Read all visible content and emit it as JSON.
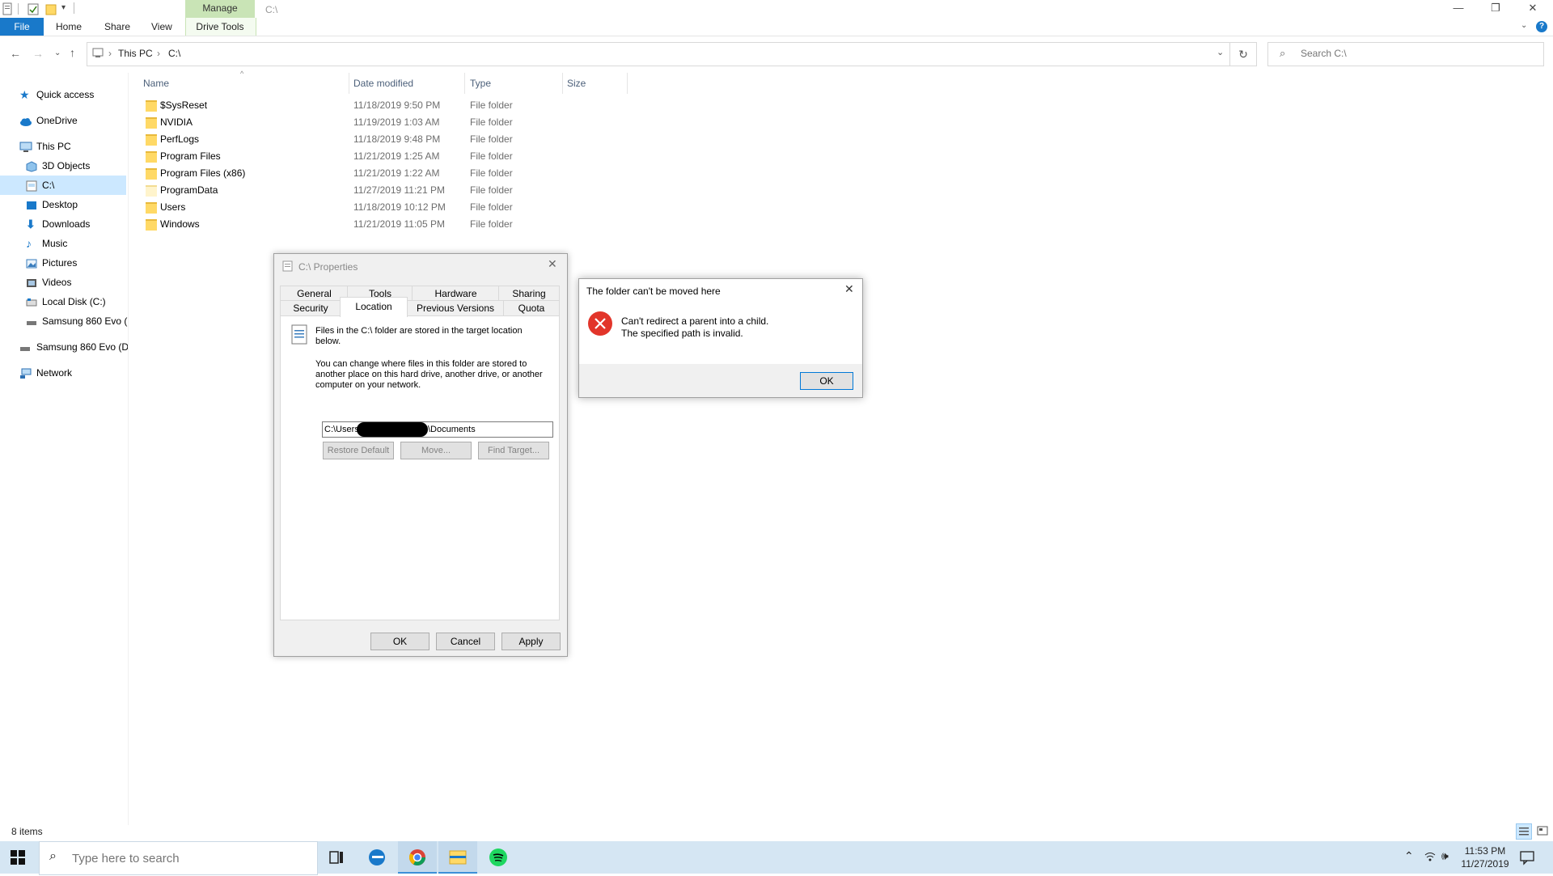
{
  "window": {
    "title": "C:\\",
    "manage_label": "Manage",
    "drive_tools_label": "Drive Tools",
    "controls": [
      "—",
      "❐",
      "✕"
    ]
  },
  "ribbon": {
    "file": "File",
    "tabs": [
      "Home",
      "Share",
      "View"
    ],
    "help": "?"
  },
  "address": {
    "crumbs": [
      "This PC",
      "C:\\"
    ],
    "search_placeholder": "Search C:\\"
  },
  "nav": {
    "items": [
      {
        "label": "Quick access",
        "icon": "star-icon"
      },
      {
        "label": "OneDrive",
        "icon": "cloud-icon"
      },
      {
        "label": "This PC",
        "icon": "computer-icon"
      },
      {
        "label": "3D Objects",
        "icon": "cube-icon"
      },
      {
        "label": "C:\\",
        "icon": "drive-icon"
      },
      {
        "label": "Desktop",
        "icon": "desktop-icon"
      },
      {
        "label": "Downloads",
        "icon": "download-icon"
      },
      {
        "label": "Music",
        "icon": "music-icon"
      },
      {
        "label": "Pictures",
        "icon": "pictures-icon"
      },
      {
        "label": "Videos",
        "icon": "video-icon"
      },
      {
        "label": "Local Disk (C:)",
        "icon": "drive-icon"
      },
      {
        "label": "Samsung 860 Evo (",
        "icon": "drive-icon"
      },
      {
        "label": "Samsung 860 Evo  (D:",
        "icon": "drive-icon"
      },
      {
        "label": "Network",
        "icon": "network-icon"
      }
    ]
  },
  "columns": [
    "Name",
    "Date modified",
    "Type",
    "Size"
  ],
  "files": [
    {
      "name": "$SysReset",
      "date": "11/18/2019 9:50 PM",
      "type": "File folder"
    },
    {
      "name": "NVIDIA",
      "date": "11/19/2019 1:03 AM",
      "type": "File folder"
    },
    {
      "name": "PerfLogs",
      "date": "11/18/2019 9:48 PM",
      "type": "File folder"
    },
    {
      "name": "Program Files",
      "date": "11/21/2019 1:25 AM",
      "type": "File folder"
    },
    {
      "name": "Program Files (x86)",
      "date": "11/21/2019 1:22 AM",
      "type": "File folder"
    },
    {
      "name": "ProgramData",
      "date": "11/27/2019 11:21 PM",
      "type": "File folder"
    },
    {
      "name": "Users",
      "date": "11/18/2019 10:12 PM",
      "type": "File folder"
    },
    {
      "name": "Windows",
      "date": "11/21/2019 11:05 PM",
      "type": "File folder"
    }
  ],
  "status": {
    "items": "8 items"
  },
  "props": {
    "title": "C:\\ Properties",
    "tabs_row1": [
      "General",
      "Tools",
      "Hardware",
      "Sharing"
    ],
    "tabs_row2": [
      "Security",
      "Location",
      "Previous Versions",
      "Quota"
    ],
    "info_line1": "Files in the C:\\ folder are stored in the target location",
    "info_line2": "below.",
    "desc_line1": "You can change where files in this folder are stored to",
    "desc_line2": "another place on this hard drive, another drive, or another",
    "desc_line3": "computer on your network.",
    "path_start": "C:\\Users",
    "path_end": "\\Documents",
    "restore_default": "Restore Default",
    "move": "Move...",
    "find_target": "Find Target...",
    "ok": "OK",
    "cancel": "Cancel",
    "apply": "Apply"
  },
  "error": {
    "title": "The folder can't be moved here",
    "line1": "Can't redirect a parent into a child.",
    "line2": "The specified path is invalid.",
    "ok": "OK"
  },
  "taskbar": {
    "search_placeholder": "Type here to search",
    "time": "11:53 PM",
    "date": "11/27/2019"
  }
}
